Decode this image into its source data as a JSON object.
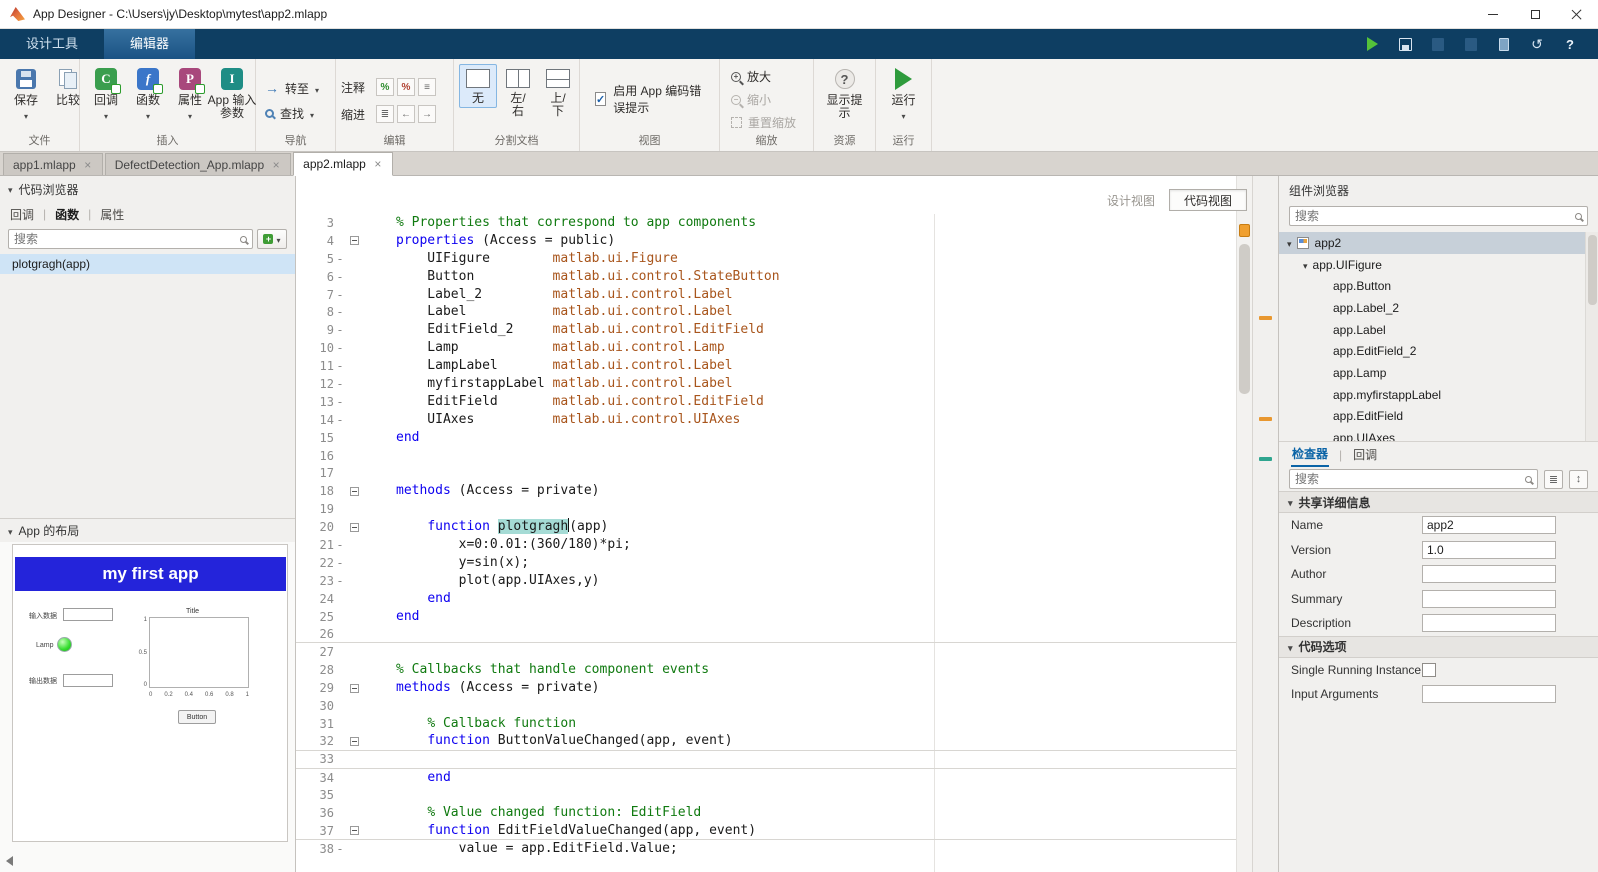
{
  "colors": {
    "toolstrip_navy": "#0e3e62",
    "run_green": "#2e9b3c",
    "keyword_blue": "#0d00f0",
    "comment_green": "#107a10",
    "type_brown": "#a8551c",
    "selection_teal": "#a5dbd5",
    "banner_blue": "#2424da",
    "warning_orange": "#f0a030",
    "list_selection_blue": "#cfe4f6"
  },
  "titlebar": {
    "title": "App Designer - C:\\Users\\jy\\Desktop\\mytest\\app2.mlapp"
  },
  "ribbon_tabs": {
    "design": "设计工具",
    "editor": "编辑器"
  },
  "ribbon": {
    "file": {
      "group": "文件",
      "save": "保存",
      "compare": "比较"
    },
    "insert": {
      "group": "插入",
      "callback": "回调",
      "func": "函数",
      "property": "属性",
      "app_input": "App 输入参数"
    },
    "navigate": {
      "group": "导航",
      "goto": "转至",
      "find": "查找"
    },
    "edit": {
      "group": "编辑",
      "comment": "注释",
      "indent": "缩进"
    },
    "split": {
      "group": "分割文档",
      "none": "无",
      "left_right": "左/右",
      "top_bottom": "上/下"
    },
    "view": {
      "group": "视图",
      "checkbox_label": "启用 App 编码错误提示",
      "checked": true
    },
    "zoom": {
      "group": "缩放",
      "zoom_in": "放大",
      "zoom_out": "缩小",
      "reset": "重置缩放"
    },
    "resources": {
      "group": "资源",
      "tips": "显示提示"
    },
    "run": {
      "group": "运行",
      "run": "运行"
    }
  },
  "doc_tabs": [
    {
      "label": "app1.mlapp",
      "active": false
    },
    {
      "label": "DefectDetection_App.mlapp",
      "active": false
    },
    {
      "label": "app2.mlapp",
      "active": true
    }
  ],
  "left_panel": {
    "code_browser": {
      "title": "代码浏览器",
      "tabs": [
        "回调",
        "函数",
        "属性"
      ],
      "active_tab": "函数",
      "search_placeholder": "搜索",
      "items": [
        {
          "label": "plotgragh(app)",
          "selected": true
        }
      ]
    },
    "app_layout": {
      "title": "App 的布局",
      "banner": "my first app",
      "label_1": "输入数据",
      "lamp_label": "Lamp",
      "label_2": "输出数据",
      "button_label": "Button",
      "axes_title": "Title",
      "x_ticks": [
        "0",
        "0.2",
        "0.4",
        "0.6",
        "0.8",
        "1"
      ],
      "y_ticks": [
        "1",
        "0.5",
        "0"
      ]
    }
  },
  "editor": {
    "design_view": "设计视图",
    "code_view": "代码视图",
    "active_view": "code",
    "marks": [
      {
        "y": 140,
        "color": "#e8972f"
      },
      {
        "y": 241,
        "color": "#e8972f"
      },
      {
        "y": 281,
        "color": "#2fa58f"
      }
    ],
    "lines": [
      {
        "n": 3,
        "s": [
          [
            "c",
            "% Properties that correspond to app components"
          ]
        ]
      },
      {
        "n": 4,
        "f": true,
        "s": [
          [
            "k",
            "properties"
          ],
          [
            "p",
            " (Access = public)"
          ]
        ]
      },
      {
        "n": 5,
        "d": true,
        "s": [
          [
            "p",
            "    UIFigure        "
          ],
          [
            "t",
            "matlab.ui.Figure"
          ]
        ]
      },
      {
        "n": 6,
        "d": true,
        "s": [
          [
            "p",
            "    Button          "
          ],
          [
            "t",
            "matlab.ui.control.StateButton"
          ]
        ]
      },
      {
        "n": 7,
        "d": true,
        "s": [
          [
            "p",
            "    Label_2         "
          ],
          [
            "t",
            "matlab.ui.control.Label"
          ]
        ]
      },
      {
        "n": 8,
        "d": true,
        "s": [
          [
            "p",
            "    Label           "
          ],
          [
            "t",
            "matlab.ui.control.Label"
          ]
        ]
      },
      {
        "n": 9,
        "d": true,
        "s": [
          [
            "p",
            "    EditField_2     "
          ],
          [
            "t",
            "matlab.ui.control.EditField"
          ]
        ]
      },
      {
        "n": 10,
        "d": true,
        "s": [
          [
            "p",
            "    Lamp            "
          ],
          [
            "t",
            "matlab.ui.control.Lamp"
          ]
        ]
      },
      {
        "n": 11,
        "d": true,
        "s": [
          [
            "p",
            "    LampLabel       "
          ],
          [
            "t",
            "matlab.ui.control.Label"
          ]
        ]
      },
      {
        "n": 12,
        "d": true,
        "s": [
          [
            "p",
            "    myfirstappLabel "
          ],
          [
            "t",
            "matlab.ui.control.Label"
          ]
        ]
      },
      {
        "n": 13,
        "d": true,
        "s": [
          [
            "p",
            "    EditField       "
          ],
          [
            "t",
            "matlab.ui.control.EditField"
          ]
        ]
      },
      {
        "n": 14,
        "d": true,
        "s": [
          [
            "p",
            "    UIAxes          "
          ],
          [
            "t",
            "matlab.ui.control.UIAxes"
          ]
        ]
      },
      {
        "n": 15,
        "s": [
          [
            "k",
            "end"
          ]
        ]
      },
      {
        "n": 16,
        "s": []
      },
      {
        "n": 17,
        "s": []
      },
      {
        "n": 18,
        "f": true,
        "s": [
          [
            "k",
            "methods"
          ],
          [
            "p",
            " (Access = private)"
          ]
        ]
      },
      {
        "n": 19,
        "s": []
      },
      {
        "n": 20,
        "f": true,
        "s": [
          [
            "p",
            "    "
          ],
          [
            "k",
            "function"
          ],
          [
            "p",
            " "
          ],
          [
            "sel",
            "plotgragh"
          ],
          [
            "caret",
            ""
          ],
          [
            "p",
            "(app)"
          ]
        ]
      },
      {
        "n": 21,
        "d": true,
        "s": [
          [
            "p",
            "        x=0:0.01:(360/180)*pi;"
          ]
        ]
      },
      {
        "n": 22,
        "d": true,
        "s": [
          [
            "p",
            "        y=sin(x);"
          ]
        ]
      },
      {
        "n": 23,
        "d": true,
        "s": [
          [
            "p",
            "        plot(app.UIAxes,y)"
          ]
        ]
      },
      {
        "n": 24,
        "s": [
          [
            "p",
            "    "
          ],
          [
            "k",
            "end"
          ]
        ]
      },
      {
        "n": 25,
        "s": [
          [
            "k",
            "end"
          ]
        ]
      },
      {
        "n": 26,
        "sep": true,
        "s": []
      },
      {
        "n": 27,
        "s": []
      },
      {
        "n": 28,
        "s": [
          [
            "c",
            "% Callbacks that handle component events"
          ]
        ]
      },
      {
        "n": 29,
        "f": true,
        "s": [
          [
            "k",
            "methods"
          ],
          [
            "p",
            " (Access = private)"
          ]
        ]
      },
      {
        "n": 30,
        "s": []
      },
      {
        "n": 31,
        "s": [
          [
            "p",
            "    "
          ],
          [
            "c",
            "% Callback function"
          ]
        ]
      },
      {
        "n": 32,
        "f": true,
        "sep": true,
        "s": [
          [
            "p",
            "    "
          ],
          [
            "k",
            "function"
          ],
          [
            "p",
            " ButtonValueChanged(app, event)"
          ]
        ]
      },
      {
        "n": 33,
        "sep": true,
        "s": []
      },
      {
        "n": 34,
        "s": [
          [
            "p",
            "    "
          ],
          [
            "k",
            "end"
          ]
        ]
      },
      {
        "n": 35,
        "s": []
      },
      {
        "n": 36,
        "s": [
          [
            "p",
            "    "
          ],
          [
            "c",
            "% Value changed function: EditField"
          ]
        ]
      },
      {
        "n": 37,
        "f": true,
        "sep": true,
        "s": [
          [
            "p",
            "    "
          ],
          [
            "k",
            "function"
          ],
          [
            "p",
            " EditFieldValueChanged(app, event)"
          ]
        ]
      },
      {
        "n": 38,
        "d": true,
        "s": [
          [
            "p",
            "        value = app.EditField.Value;"
          ]
        ]
      }
    ]
  },
  "right_panel": {
    "component_browser": {
      "title": "组件浏览器",
      "search_placeholder": "搜索",
      "root": "app2",
      "figure": "app.UIFigure",
      "children": [
        "app.Button",
        "app.Label_2",
        "app.Label",
        "app.EditField_2",
        "app.Lamp",
        "app.myfirstappLabel",
        "app.EditField",
        "app.UIAxes"
      ]
    },
    "inspector": {
      "tabs": [
        "检查器",
        "回调"
      ],
      "active_tab": "检查器",
      "search_placeholder": "搜索",
      "sections": [
        {
          "title": "共享详细信息",
          "rows": [
            {
              "label": "Name",
              "type": "text",
              "value": "app2"
            },
            {
              "label": "Version",
              "type": "text",
              "value": "1.0"
            },
            {
              "label": "Author",
              "type": "text",
              "value": ""
            },
            {
              "label": "Summary",
              "type": "text",
              "value": ""
            },
            {
              "label": "Description",
              "type": "text",
              "value": ""
            }
          ]
        },
        {
          "title": "代码选项",
          "rows": [
            {
              "label": "Single Running Instance",
              "type": "checkbox",
              "checked": false
            },
            {
              "label": "Input Arguments",
              "type": "text",
              "value": ""
            }
          ]
        }
      ]
    }
  }
}
